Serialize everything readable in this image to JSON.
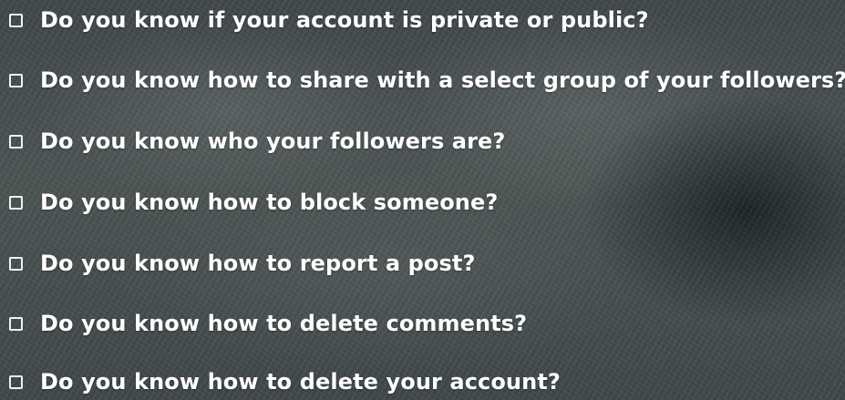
{
  "checklist": {
    "items": [
      {
        "label": "Do you know if your account is private or public?",
        "checked": false
      },
      {
        "label": "Do you know how to share with a select group of your followers?",
        "checked": false
      },
      {
        "label": "Do you know who your followers are?",
        "checked": false
      },
      {
        "label": "Do you know how to block someone?",
        "checked": false
      },
      {
        "label": "Do you know how to report a post?",
        "checked": false
      },
      {
        "label": "Do you know how to delete comments?",
        "checked": false
      },
      {
        "label": "Do you know how to delete your account?",
        "checked": false
      }
    ]
  },
  "colors": {
    "text": "#ffffff",
    "checkbox_border": "#f0f2f2",
    "background": "#454d4e"
  }
}
